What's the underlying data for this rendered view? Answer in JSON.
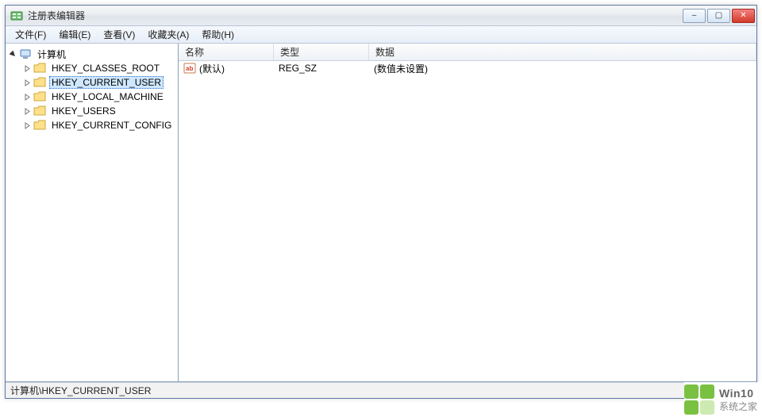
{
  "window": {
    "title": "注册表编辑器",
    "controls": {
      "min": "–",
      "max": "▢",
      "close": "✕"
    }
  },
  "menubar": [
    {
      "label": "文件(F)"
    },
    {
      "label": "编辑(E)"
    },
    {
      "label": "查看(V)"
    },
    {
      "label": "收藏夹(A)"
    },
    {
      "label": "帮助(H)"
    }
  ],
  "tree": {
    "root": {
      "label": "计算机",
      "expanded": true,
      "children": [
        {
          "label": "HKEY_CLASSES_ROOT",
          "selected": false
        },
        {
          "label": "HKEY_CURRENT_USER",
          "selected": true
        },
        {
          "label": "HKEY_LOCAL_MACHINE",
          "selected": false
        },
        {
          "label": "HKEY_USERS",
          "selected": false
        },
        {
          "label": "HKEY_CURRENT_CONFIG",
          "selected": false
        }
      ]
    }
  },
  "list": {
    "columns": {
      "name": "名称",
      "type": "类型",
      "data": "数据"
    },
    "rows": [
      {
        "name": "(默认)",
        "type": "REG_SZ",
        "data": "(数值未设置)",
        "icon": "string-value-icon"
      }
    ]
  },
  "statusbar": {
    "path": "计算机\\HKEY_CURRENT_USER"
  },
  "watermark": {
    "colors": [
      "#7ac142",
      "#7ac142",
      "#7ac142",
      "#cdeab2"
    ],
    "line1": "Win10",
    "line2": "系统之家"
  }
}
